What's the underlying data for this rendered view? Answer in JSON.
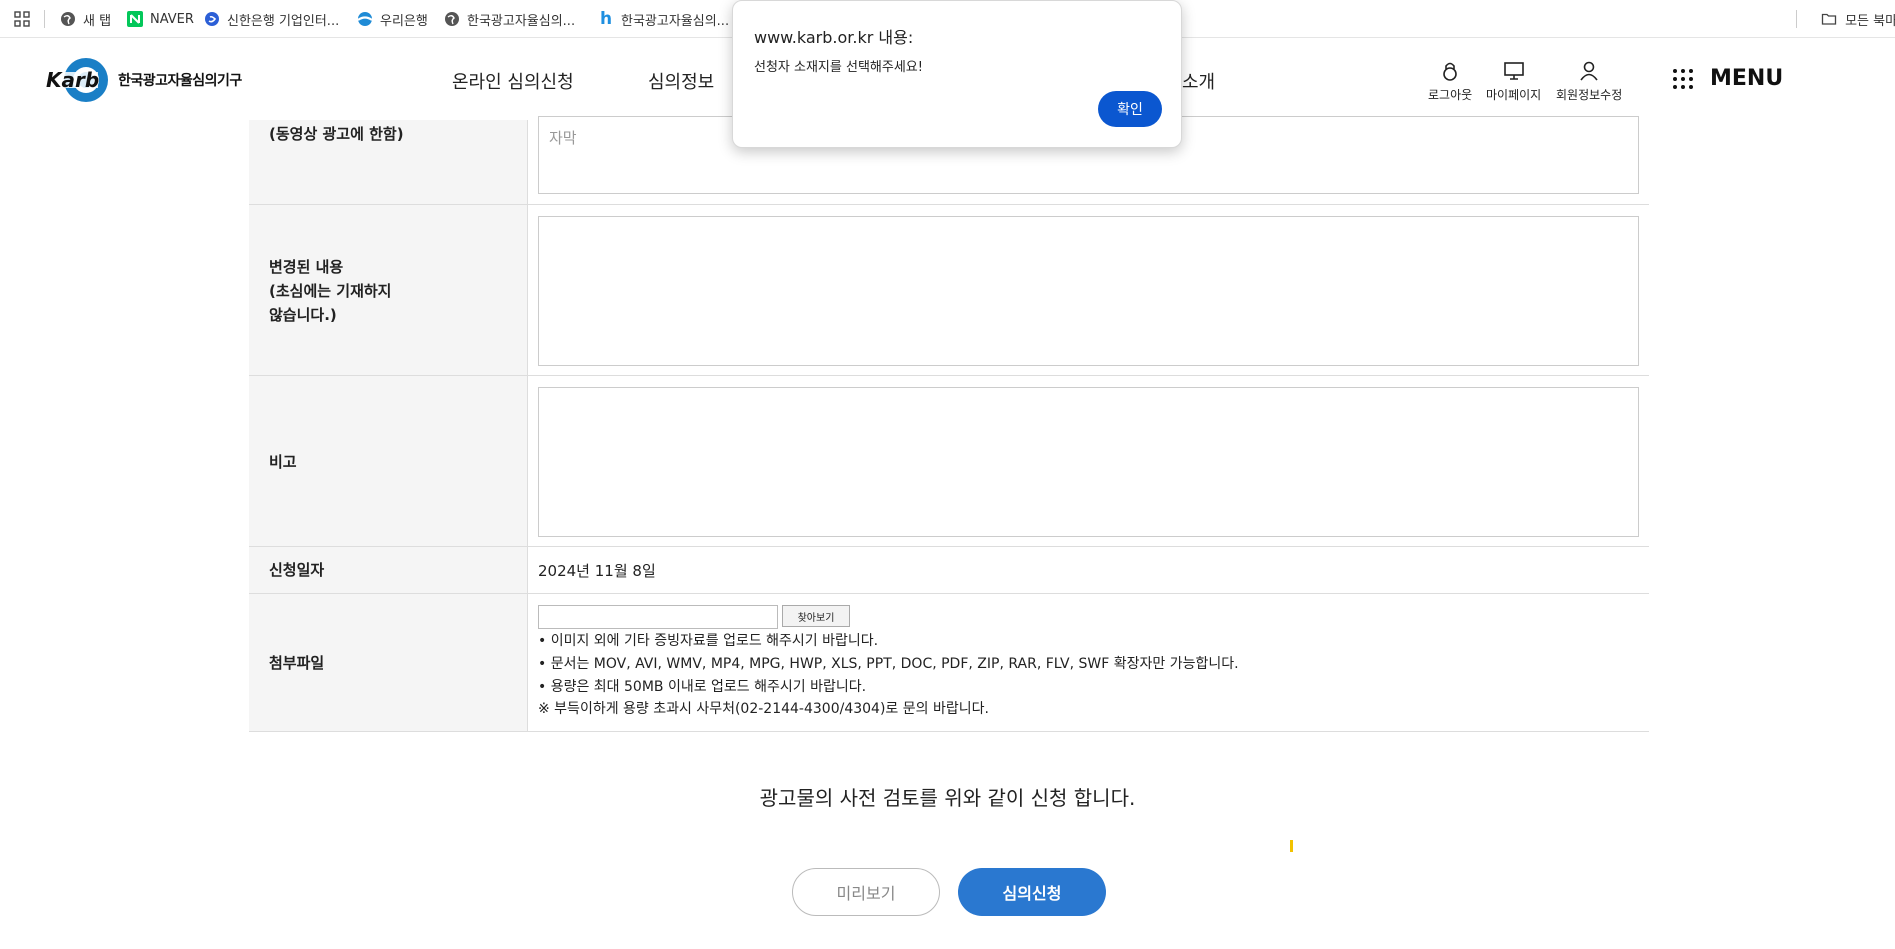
{
  "bookmarks": {
    "items": [
      {
        "label": "새 탭",
        "icon": "globe-icon"
      },
      {
        "label": "NAVER",
        "icon": "naver-icon"
      },
      {
        "label": "신한은행 기업인터...",
        "icon": "shinhan-icon"
      },
      {
        "label": "우리은행",
        "icon": "woori-icon"
      },
      {
        "label": "한국광고자율심의...",
        "icon": "globe-icon"
      },
      {
        "label": "한국광고자율심의...",
        "icon": "h-icon"
      }
    ],
    "all_bookmarks": "모든 북마크"
  },
  "header": {
    "logo_mark": "Karb",
    "logo_text": "한국광고자율심의기구",
    "nav": [
      "온라인 심의신청",
      "심의정보",
      "소개"
    ],
    "util": [
      "로그아웃",
      "마이페이지",
      "회원정보수정"
    ],
    "menu_label": "MENU"
  },
  "form": {
    "rows": [
      {
        "label": "(동영상 광고에 한함)",
        "placeholder": "자막"
      },
      {
        "label_lines": [
          "변경된 내용",
          "(초심에는 기재하지",
          "않습니다.)"
        ]
      },
      {
        "label": "비고"
      },
      {
        "label": "신청일자",
        "value": "2024년 11월 8일"
      },
      {
        "label": "첨부파일",
        "browse_label": "찾아보기",
        "notices": [
          "• 이미지 외에 기타 증빙자료를 업로드 해주시기 바랍니다.",
          "• 문서는 MOV, AVI, WMV, MP4, MPG, HWP, XLS, PPT, DOC, PDF, ZIP, RAR, FLV, SWF 확장자만 가능합니다.",
          "• 용량은 최대 50MB 이내로 업로드 해주시기 바랍니다.",
          "※ 부득이하게 용량 초과시 사무처(02-2144-4300/4304)로 문의 바랍니다."
        ]
      }
    ]
  },
  "confirm_text": "광고물의 사전 검토를 위와 같이 신청 합니다.",
  "buttons": {
    "preview": "미리보기",
    "submit": "심의신청"
  },
  "dialog": {
    "title": "www.karb.or.kr 내용:",
    "message": "선청자 소재지를 선택해주세요!",
    "ok": "확인"
  },
  "colors": {
    "accent": "#2a78d0",
    "dialog_button": "#0b57d0",
    "label_bg": "#f5f5f5"
  }
}
